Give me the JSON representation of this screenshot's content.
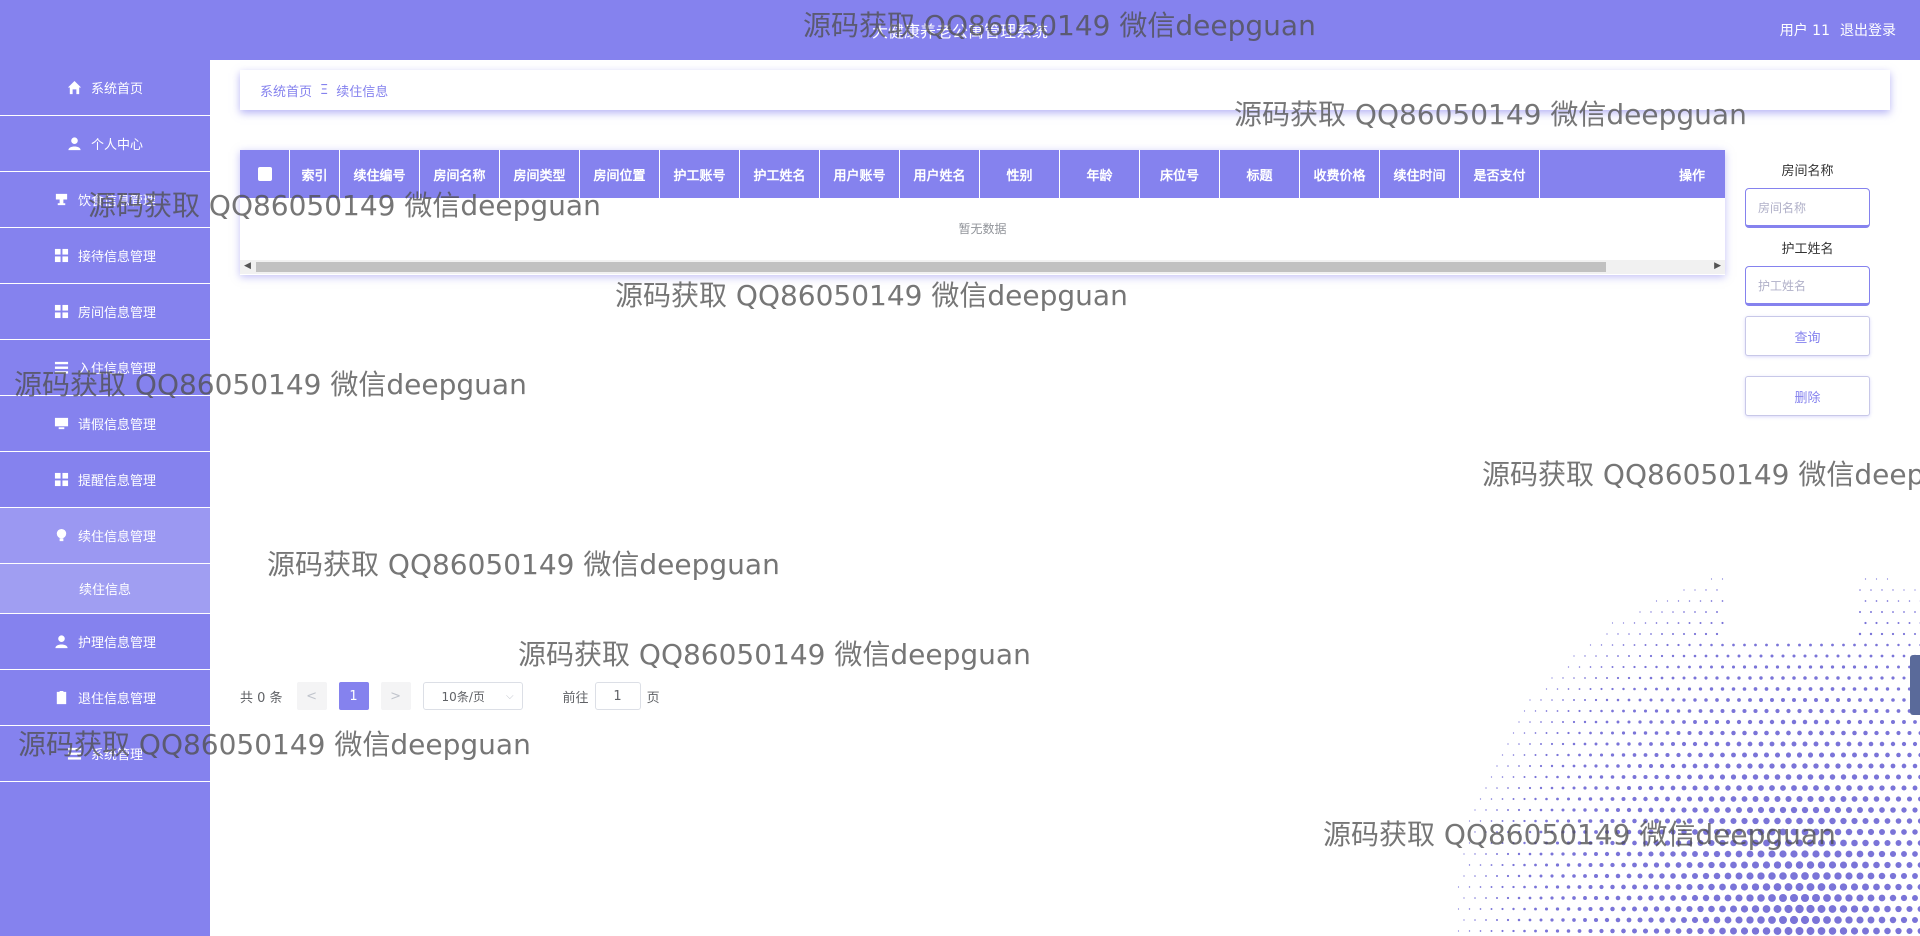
{
  "header": {
    "title": "大健康养老公寓管理系统",
    "user_label": "用户 11",
    "logout_label": "退出登录"
  },
  "sidebar": {
    "items": [
      {
        "label": "系统首页",
        "icon": "home-icon"
      },
      {
        "label": "个人中心",
        "icon": "user-icon"
      },
      {
        "label": "饮食信息管理",
        "icon": "cup-icon"
      },
      {
        "label": "接待信息管理",
        "icon": "grid-icon"
      },
      {
        "label": "房间信息管理",
        "icon": "grid-icon"
      },
      {
        "label": "入住信息管理",
        "icon": "list-icon"
      },
      {
        "label": "请假信息管理",
        "icon": "monitor-icon"
      },
      {
        "label": "提醒信息管理",
        "icon": "grid-icon"
      },
      {
        "label": "续住信息管理",
        "icon": "bulb-icon"
      },
      {
        "label": "护理信息管理",
        "icon": "user-icon"
      },
      {
        "label": "退住信息管理",
        "icon": "clipboard-icon"
      },
      {
        "label": "系统管理",
        "icon": "list-icon"
      }
    ],
    "sub_item": "续住信息"
  },
  "breadcrumb": {
    "home": "系统首页",
    "separator": "Ξ",
    "current": "续住信息"
  },
  "table": {
    "columns": [
      "索引",
      "续住编号",
      "房间名称",
      "房间类型",
      "房间位置",
      "护工账号",
      "护工姓名",
      "用户账号",
      "用户姓名",
      "性别",
      "年龄",
      "床位号",
      "标题",
      "收费价格",
      "续住时间",
      "是否支付",
      "操作"
    ],
    "empty_text": "暂无数据"
  },
  "search": {
    "room_label": "房间名称",
    "room_placeholder": "房间名称",
    "nurse_label": "护工姓名",
    "nurse_placeholder": "护工姓名",
    "query_button": "查询",
    "delete_button": "删除"
  },
  "pagination": {
    "total": "共 0 条",
    "prev": "<",
    "current_page": "1",
    "next": ">",
    "page_size": "10条/页",
    "goto_label": "前往",
    "goto_value": "1",
    "page_suffix": "页"
  },
  "watermark": "源码获取 QQ86050149 微信deepguan",
  "colors": {
    "primary": "#8582ee",
    "active_menu": "#9b98f2",
    "sub_menu": "#a09ef2"
  }
}
